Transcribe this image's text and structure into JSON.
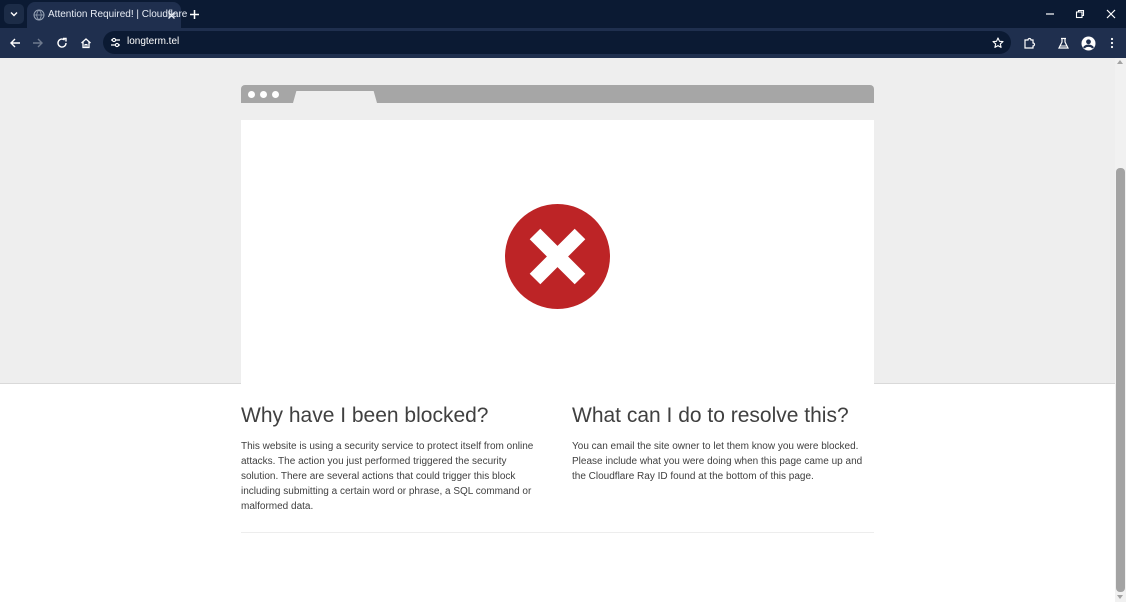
{
  "browser": {
    "tab_title": "Attention Required! | Cloudflare",
    "url": "longterm.tel",
    "colors": {
      "titlebar": "#0b1a33",
      "toolbar": "#1f2f4e",
      "active_tab": "#1f2f4e"
    }
  },
  "page": {
    "left_heading": "Why have I been blocked?",
    "left_text": "This website is using a security service to protect itself from online attacks. The action you just performed triggered the security solution. There are several actions that could trigger this block including submitting a certain word or phrase, a SQL command or malformed data.",
    "right_heading": "What can I do to resolve this?",
    "right_text": "You can email the site owner to let them know you were blocked. Please include what you were doing when this page came up and the Cloudflare Ray ID found at the bottom of this page.",
    "colors": {
      "error_red": "#bd2426",
      "text": "#404040",
      "band": "#eeeeee"
    }
  }
}
